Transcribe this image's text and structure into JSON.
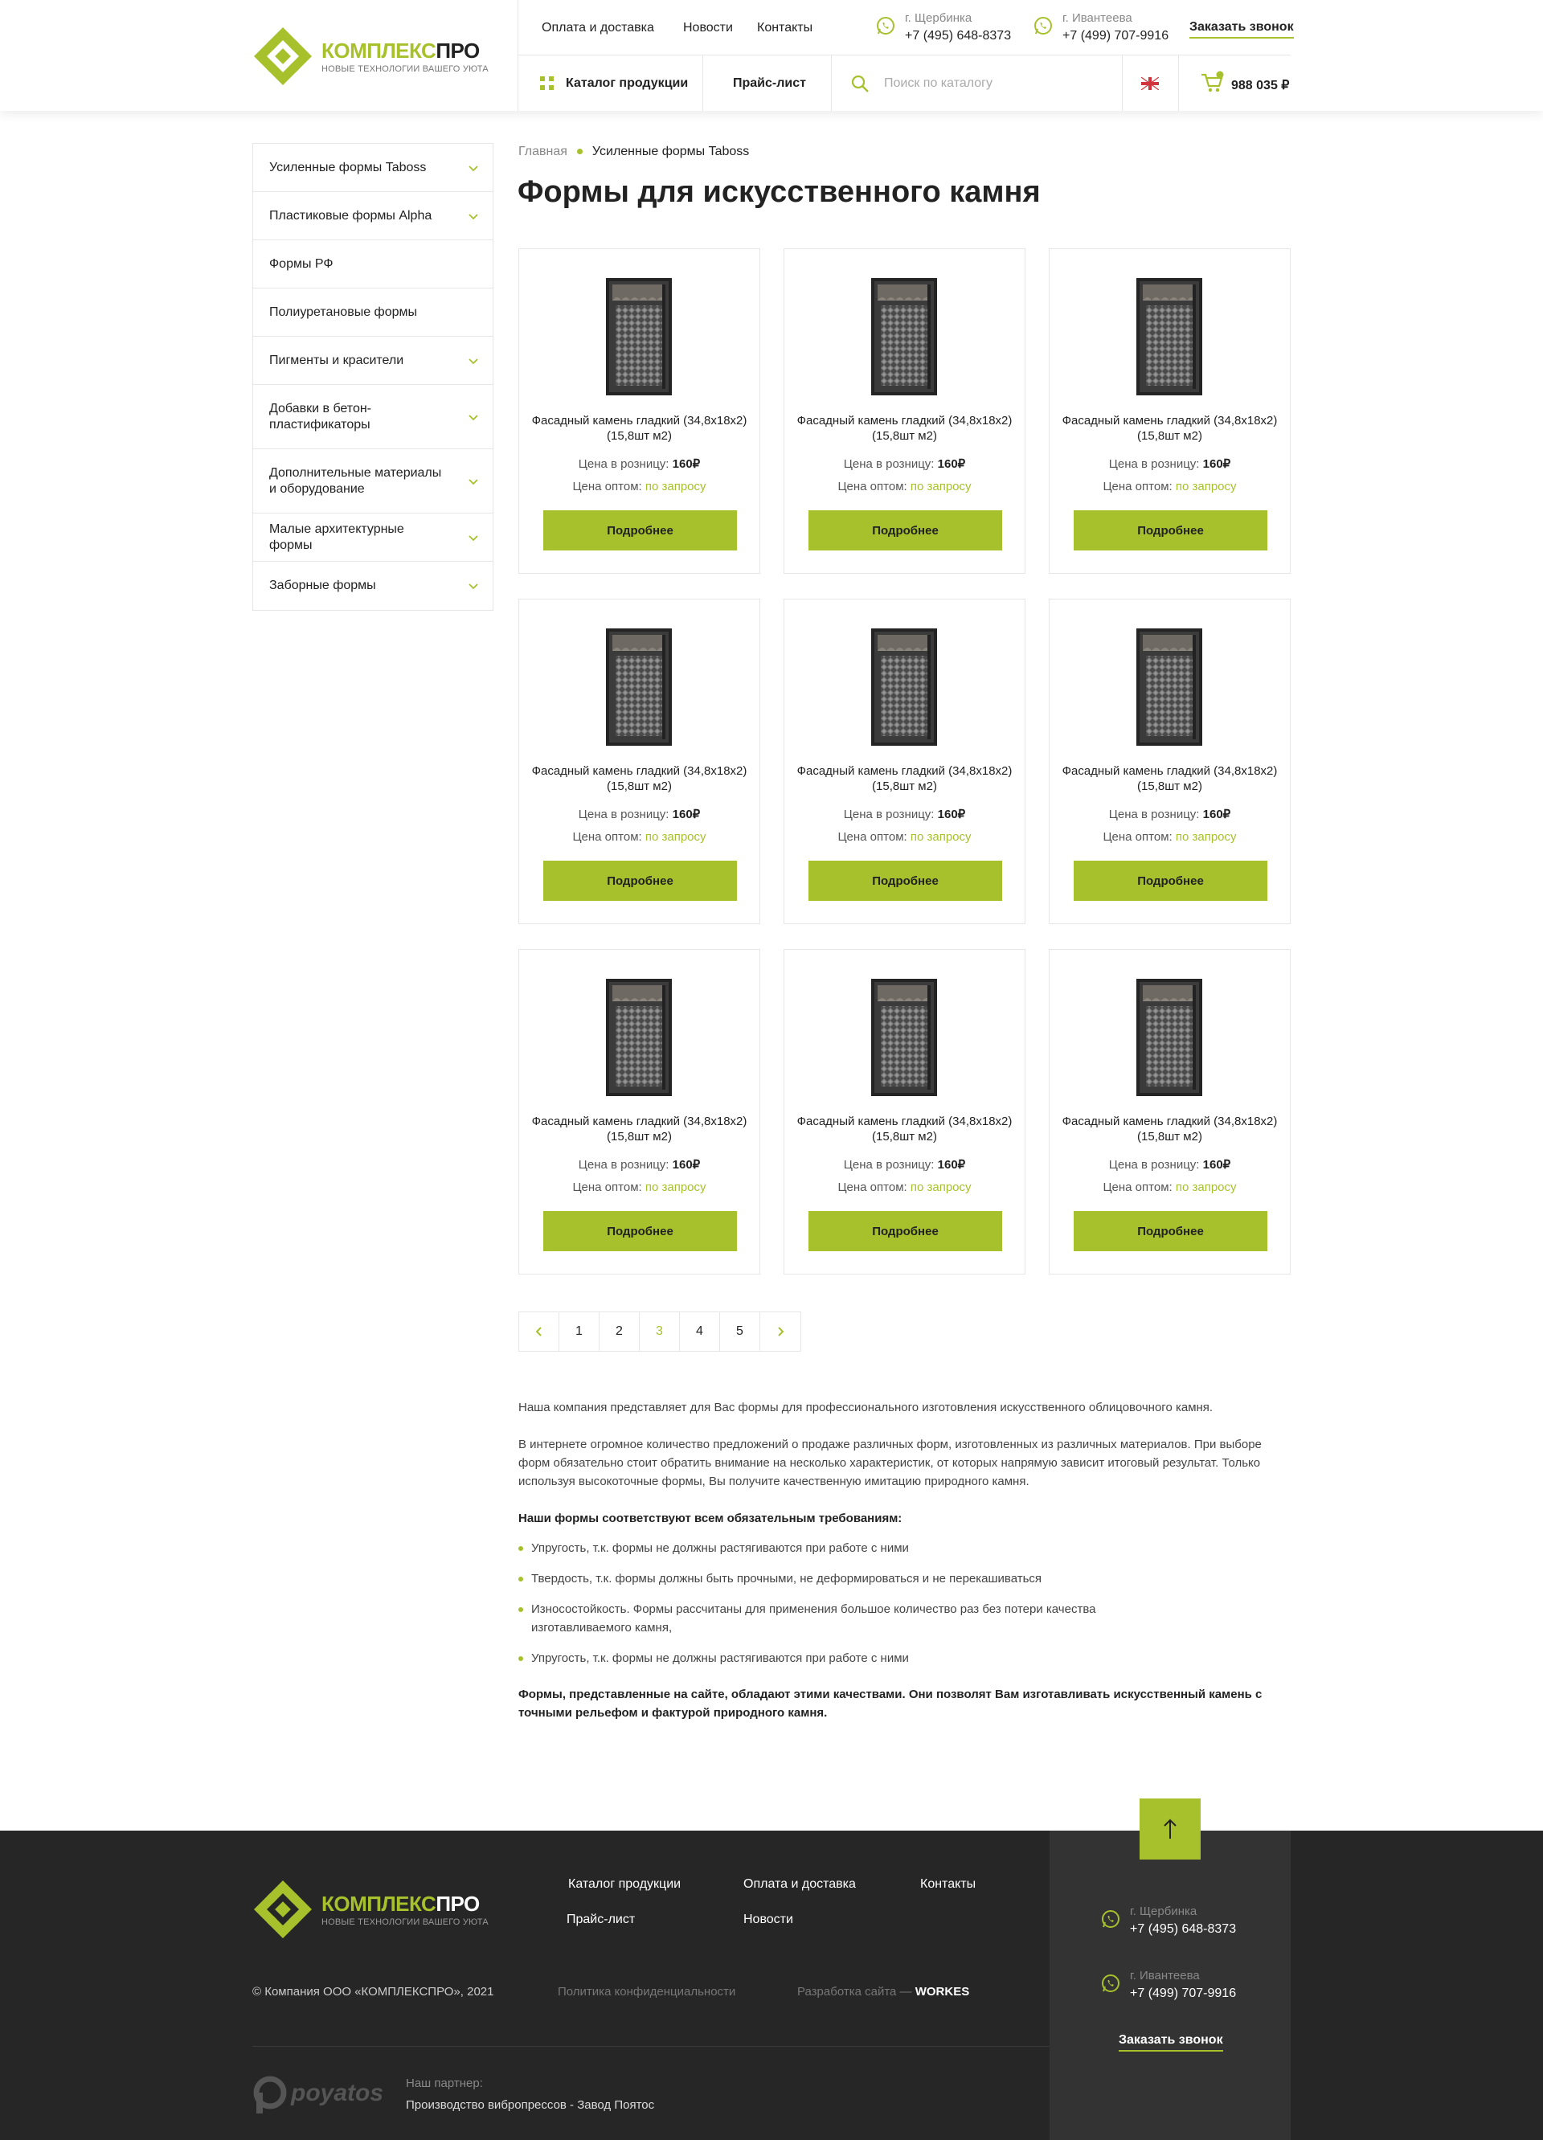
{
  "brand": {
    "name_part1": "КОМПЛЕКС",
    "name_part2": "ПРО",
    "tagline": "НОВЫЕ ТЕХНОЛОГИИ ВАШЕГО УЮТА",
    "accent_color": "#a6c12c"
  },
  "header": {
    "top_nav": [
      "Оплата и доставка",
      "Новости",
      "Контакты"
    ],
    "contacts": [
      {
        "city": "г. Щербинка",
        "phone": "+7 (495) 648-8373",
        "icon": "whatsapp-icon"
      },
      {
        "city": "г. Ивантеева",
        "phone": "+7 (499) 707-9916",
        "icon": "whatsapp-icon"
      }
    ],
    "callback_label": "Заказать звонок",
    "catalog_label": "Каталог продукции",
    "price_list_label": "Прайс-лист",
    "search_placeholder": "Поиск по каталогу",
    "language_icon": "uk-flag-icon",
    "cart_icon": "cart-icon",
    "cart_total": "988 035 ₽"
  },
  "sidebar": {
    "items": [
      {
        "label": "Усиленные формы Taboss",
        "has_children": true
      },
      {
        "label": "Пластиковые формы Alpha",
        "has_children": true
      },
      {
        "label": "Формы РФ",
        "has_children": false
      },
      {
        "label": "Полиуретановые формы",
        "has_children": false
      },
      {
        "label": "Пигменты и красители",
        "has_children": true
      },
      {
        "label": "Добавки в бетон-пластификаторы",
        "has_children": true
      },
      {
        "label": "Дополнительные материалы и оборудование",
        "has_children": true
      },
      {
        "label": "Малые архитектурные формы",
        "has_children": true
      },
      {
        "label": "Заборные формы",
        "has_children": true
      }
    ]
  },
  "breadcrumb": {
    "home": "Главная",
    "current": "Усиленные формы Taboss"
  },
  "page_title": "Формы для искусственного камня",
  "products": [
    {
      "name": "Фасадный камень гладкий (34,8x18x2) (15,8шт м2)",
      "retail_label": "Цена в розницу:",
      "retail_price": "160₽",
      "wholesale_label": "Цена оптом:",
      "wholesale_value": "по запросу",
      "button": "Подробнее"
    },
    {
      "name": "Фасадный камень гладкий (34,8x18x2) (15,8шт м2)",
      "retail_label": "Цена в розницу:",
      "retail_price": "160₽",
      "wholesale_label": "Цена оптом:",
      "wholesale_value": "по запросу",
      "button": "Подробнее"
    },
    {
      "name": "Фасадный камень гладкий (34,8x18x2) (15,8шт м2)",
      "retail_label": "Цена в розницу:",
      "retail_price": "160₽",
      "wholesale_label": "Цена оптом:",
      "wholesale_value": "по запросу",
      "button": "Подробнее"
    },
    {
      "name": "Фасадный камень гладкий (34,8x18x2) (15,8шт м2)",
      "retail_label": "Цена в розницу:",
      "retail_price": "160₽",
      "wholesale_label": "Цена оптом:",
      "wholesale_value": "по запросу",
      "button": "Подробнее"
    },
    {
      "name": "Фасадный камень гладкий (34,8x18x2) (15,8шт м2)",
      "retail_label": "Цена в розницу:",
      "retail_price": "160₽",
      "wholesale_label": "Цена оптом:",
      "wholesale_value": "по запросу",
      "button": "Подробнее"
    },
    {
      "name": "Фасадный камень гладкий (34,8x18x2) (15,8шт м2)",
      "retail_label": "Цена в розницу:",
      "retail_price": "160₽",
      "wholesale_label": "Цена оптом:",
      "wholesale_value": "по запросу",
      "button": "Подробнее"
    },
    {
      "name": "Фасадный камень гладкий (34,8x18x2) (15,8шт м2)",
      "retail_label": "Цена в розницу:",
      "retail_price": "160₽",
      "wholesale_label": "Цена оптом:",
      "wholesale_value": "по запросу",
      "button": "Подробнее"
    },
    {
      "name": "Фасадный камень гладкий (34,8x18x2) (15,8шт м2)",
      "retail_label": "Цена в розницу:",
      "retail_price": "160₽",
      "wholesale_label": "Цена оптом:",
      "wholesale_value": "по запросу",
      "button": "Подробнее"
    },
    {
      "name": "Фасадный камень гладкий (34,8x18x2) (15,8шт м2)",
      "retail_label": "Цена в розницу:",
      "retail_price": "160₽",
      "wholesale_label": "Цена оптом:",
      "wholesale_value": "по запросу",
      "button": "Подробнее"
    }
  ],
  "pagination": {
    "prev_icon": "chevron-left-icon",
    "next_icon": "chevron-right-icon",
    "pages": [
      "1",
      "2",
      "3",
      "4",
      "5"
    ],
    "active": "3"
  },
  "article": {
    "p1": "Наша компания представляет для Вас формы для профессионального изготовления искусственного облицовочного камня.",
    "p2": "В интернете огромное количество предложений о продаже различных форм, изготовленных из различных материалов. При выборе форм обязательно стоит обратить внимание на несколько характеристик, от которых напрямую зависит итоговый результат. Только используя высокоточные формы, Вы получите качественную имитацию природного камня.",
    "heading": "Наши формы соответствуют всем обязательным требованиям:",
    "bullets": [
      "Упругость, т.к. формы не должны растягиваются при работе с ними",
      "Твердость, т.к. формы должны быть прочными, не деформироваться и не перекашиваться",
      "Износостойкость. Формы рассчитаны для применения большое количество раз без потери качества изготавливаемого камня,",
      "Упругость, т.к. формы не должны растягиваются при работе с ними"
    ],
    "final": "Формы, представленные на сайте, обладают этими качествами. Они позволят Вам изготавливать искусственный камень с точными рельефом и фактурой природного камня."
  },
  "footer": {
    "to_top_icon": "arrow-up-icon",
    "nav": [
      "Каталог продукции",
      "Оплата и доставка",
      "Контакты",
      "Прайс-лист",
      "Новости"
    ],
    "copyright": "© Компания ООО «КОМПЛЕКСПРО», 2021",
    "privacy": "Политика конфиденциальности",
    "dev_prefix": "Разработка сайта —",
    "dev_name": "WORKES",
    "partner_logo_text": "poyatos",
    "partner_caption": "Наш партнер:",
    "partner_name": "Производство вибропрессов - Завод Поятос",
    "contacts": [
      {
        "city": "г. Щербинка",
        "phone": "+7 (495) 648-8373"
      },
      {
        "city": "г. Ивантеева",
        "phone": "+7 (499) 707-9916"
      }
    ],
    "callback_label": "Заказать звонок"
  }
}
